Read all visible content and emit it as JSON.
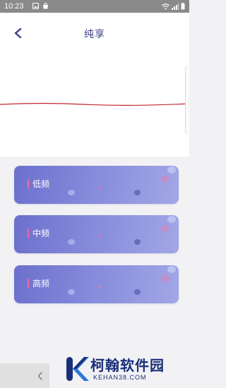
{
  "status_bar": {
    "time": "10:23",
    "left_icons": [
      "image-icon",
      "shopping-bag-icon"
    ],
    "right_icons": [
      "wifi-icon",
      "signal-icon",
      "battery-icon"
    ]
  },
  "header": {
    "title": "纯享",
    "back_icon": "chevron-left-icon"
  },
  "colors": {
    "title": "#3b3f85",
    "card_gradient_start": "#6c70cd",
    "card_gradient_end": "#a3a7e6",
    "accent": "#e96aa8",
    "wave_line": "#c0272d"
  },
  "cards": [
    {
      "label": "低频"
    },
    {
      "label": "中频"
    },
    {
      "label": "高频"
    }
  ],
  "bottom_nav": {
    "icon": "chevron-left-icon"
  },
  "watermark": {
    "logo_icon": "k-logo-icon",
    "name": "柯翰软件园",
    "url": "KEHAN38.COM"
  }
}
